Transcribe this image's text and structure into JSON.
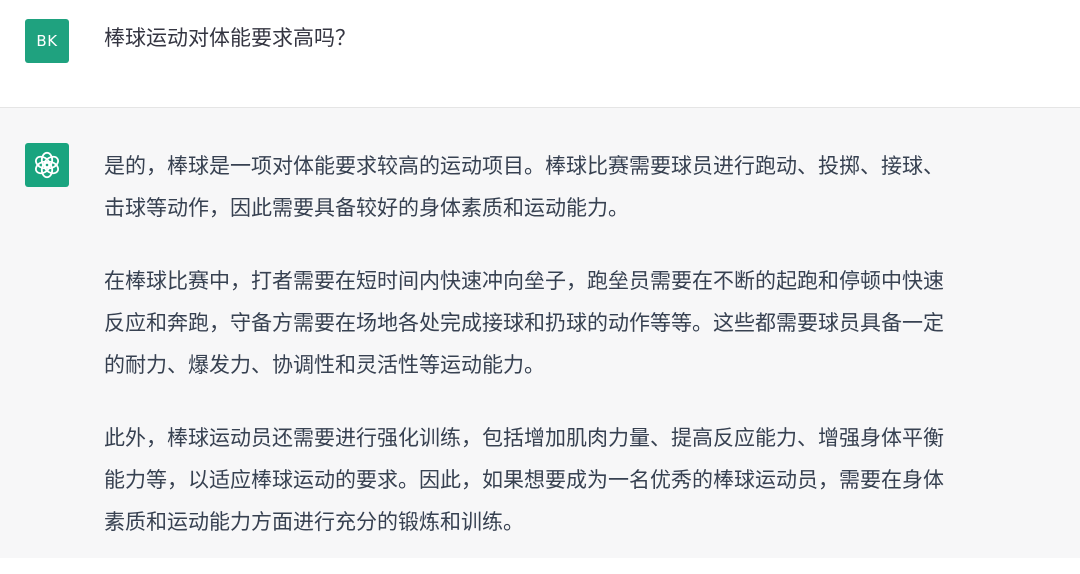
{
  "user": {
    "avatar_initials": "BK",
    "message": "棒球运动对体能要求高吗？"
  },
  "assistant": {
    "avatar_icon": "openai-logo-icon",
    "paragraphs": [
      "是的，棒球是一项对体能要求较高的运动项目。棒球比赛需要球员进行跑动、投掷、接球、\n击球等动作，因此需要具备较好的身体素质和运动能力。",
      "在棒球比赛中，打者需要在短时间内快速冲向垒子，跑垒员需要在不断的起跑和停顿中快速\n反应和奔跑，守备方需要在场地各处完成接球和扔球的动作等等。这些都需要球员具备一定\n的耐力、爆发力、协调性和灵活性等运动能力。",
      "此外，棒球运动员还需要进行强化训练，包括增加肌肉力量、提高反应能力、增强身体平衡\n能力等，以适应棒球运动的要求。因此，如果想要成为一名优秀的棒球运动员，需要在身体\n素质和运动能力方面进行充分的锻炼和训练。"
    ]
  },
  "colors": {
    "avatar_green": "#1fa27f",
    "assistant_bg": "#f7f7f8",
    "text": "#374151"
  }
}
